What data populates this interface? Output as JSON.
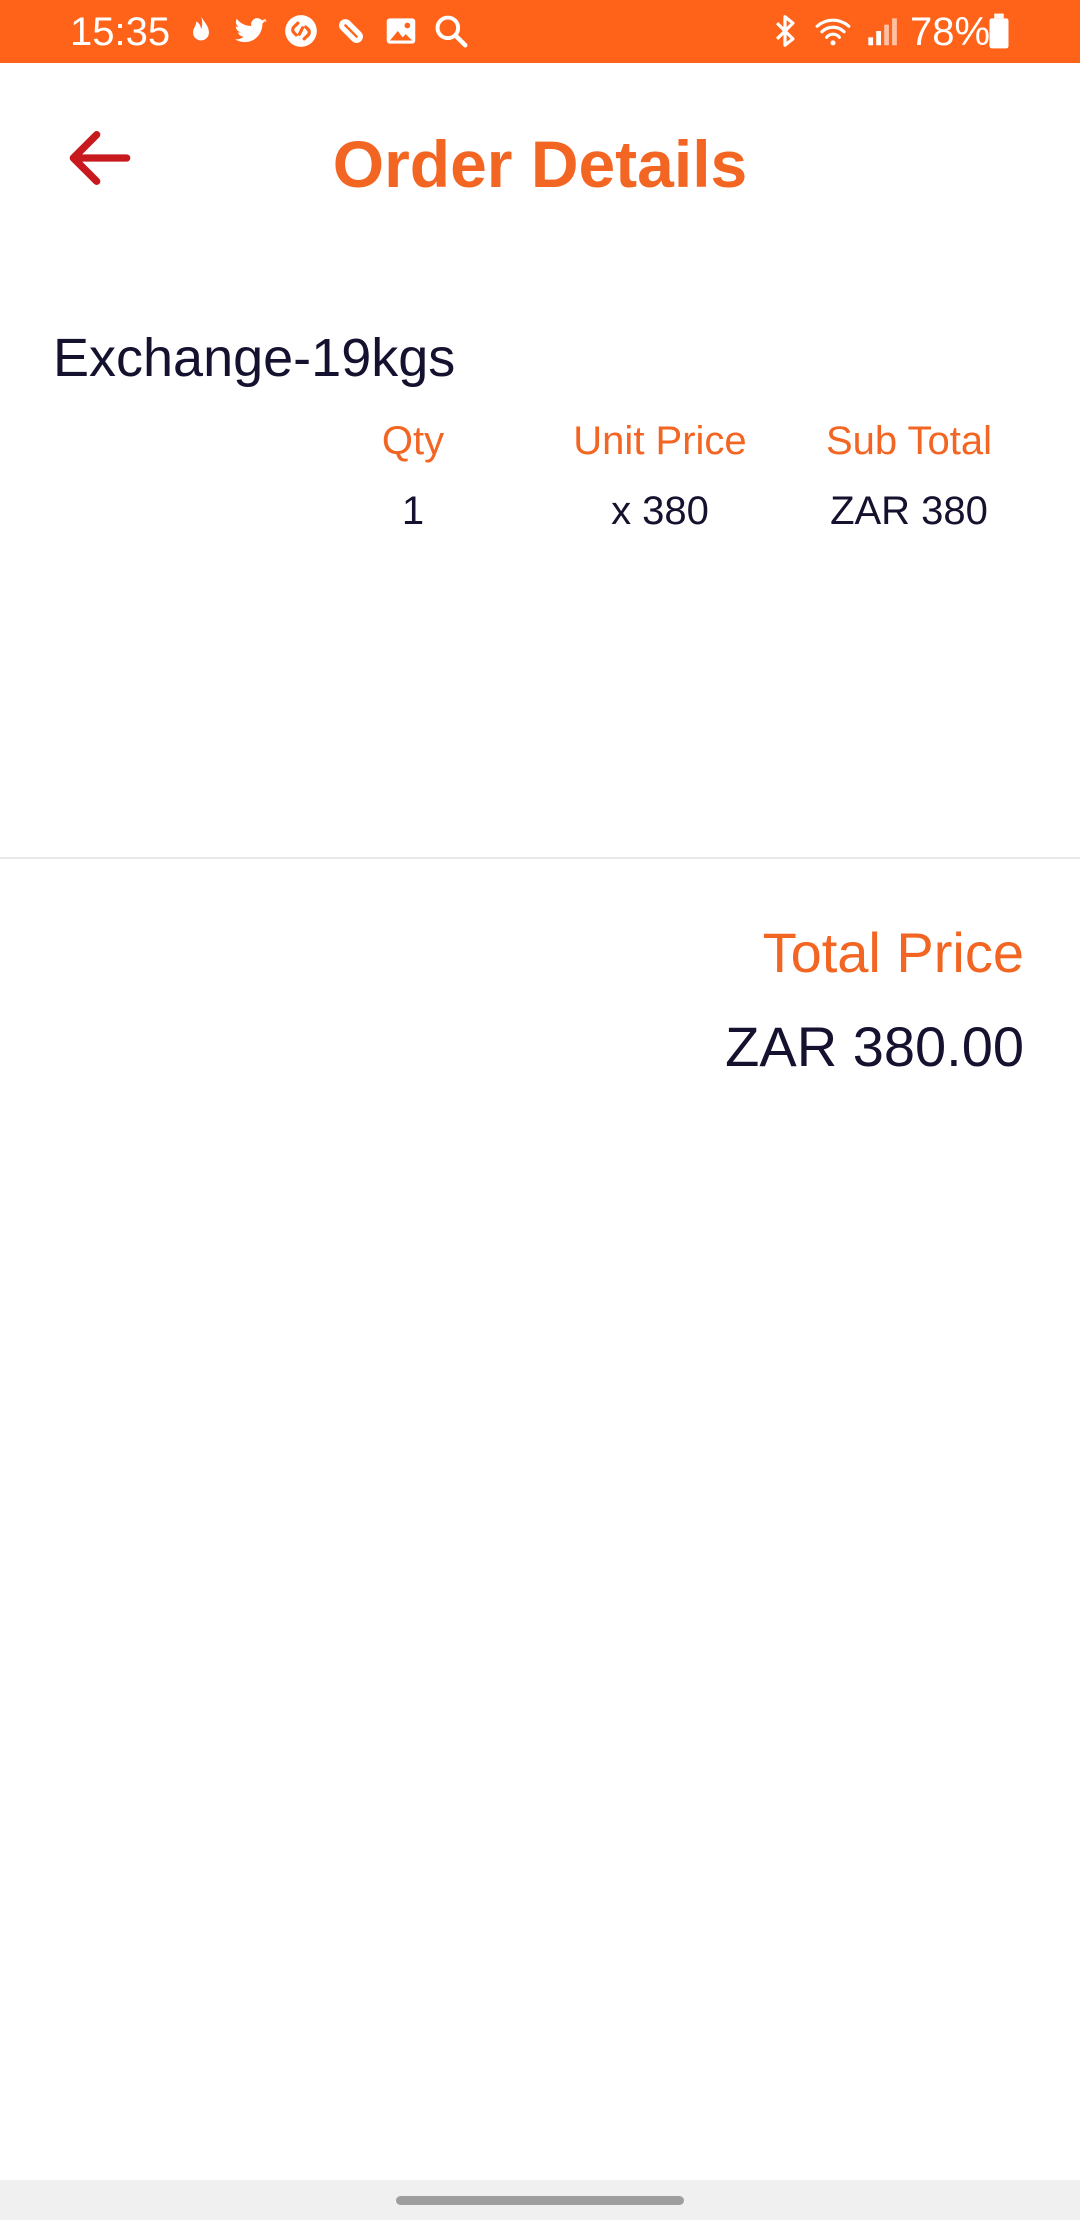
{
  "status_bar": {
    "time": "15:35",
    "battery": "78%",
    "background_color": "#ff6319",
    "left_icons": [
      "flame-icon",
      "twitter-icon",
      "shazam-icon",
      "pill-icon",
      "gallery-icon",
      "search-icon"
    ],
    "right_icons": [
      "bluetooth-icon",
      "wifi-icon",
      "signal-icon",
      "battery-icon"
    ]
  },
  "header": {
    "title": "Order Details",
    "back_icon": "arrow-left-icon",
    "accent_color": "#f26522",
    "back_color": "#c8191f"
  },
  "order": {
    "item_name": "Exchange-19kgs",
    "columns": {
      "qty_label": "Qty",
      "unit_price_label": "Unit Price",
      "sub_total_label": "Sub Total"
    },
    "values": {
      "qty": "1",
      "unit_price": "x 380",
      "sub_total": "ZAR 380"
    }
  },
  "summary": {
    "total_label": "Total Price",
    "total_value": "ZAR 380.00"
  }
}
